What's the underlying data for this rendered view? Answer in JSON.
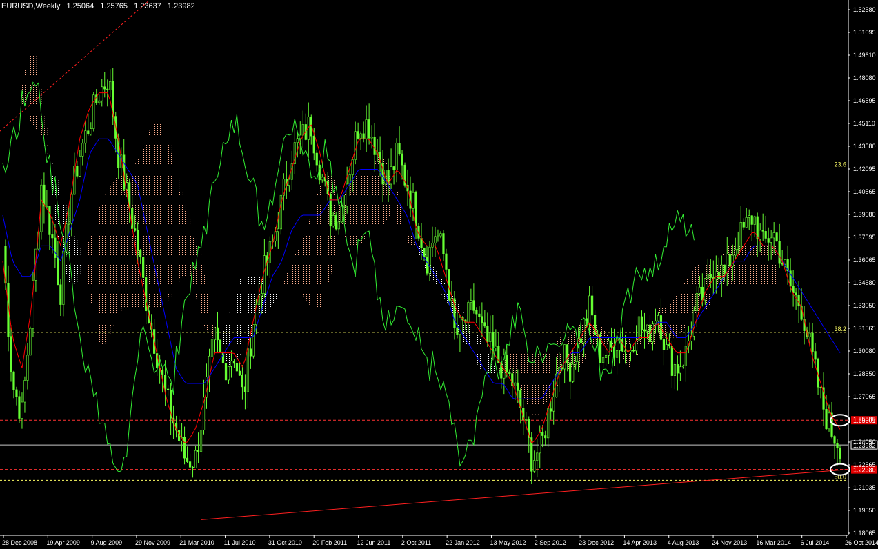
{
  "header": {
    "symbol": "EURUSD,Weekly",
    "open": "1.25064",
    "high": "1.25765",
    "low": "1.23637",
    "close": "1.23982"
  },
  "colors": {
    "background": "#000000",
    "candle": "#66ff33",
    "lagging": "#33ee33",
    "tenkan": "#ff0000",
    "kijun": "#0000ff",
    "cloud_bull": "#ffb090",
    "cloud_bear": "#ffffff",
    "fib": "#ffff66",
    "level": "#ff3333",
    "grid_axis": "#ffffff"
  },
  "chart_data": {
    "type": "candlestick",
    "title": "EURUSD,Weekly",
    "ylim": [
      1.1808,
      1.5307
    ],
    "y_ticks": [
      "1.52580",
      "1.51095",
      "1.49610",
      "1.48080",
      "1.46595",
      "1.45110",
      "1.43580",
      "1.42095",
      "1.40565",
      "1.39080",
      "1.37595",
      "1.36065",
      "1.34580",
      "1.33050",
      "1.31565",
      "1.30080",
      "1.28550",
      "1.27065",
      "1.25580",
      "1.24050",
      "1.22565",
      "1.21035",
      "1.19550",
      "1.18065"
    ],
    "x_ticks": [
      "28 Dec 2008",
      "19 Apr 2009",
      "9 Aug 2009",
      "29 Nov 2009",
      "21 Mar 2010",
      "11 Jul 2010",
      "31 Oct 2010",
      "20 Feb 2011",
      "12 Jun 2011",
      "2 Oct 2011",
      "22 Jan 2012",
      "13 May 2012",
      "2 Sep 2012",
      "23 Dec 2012",
      "14 Apr 2013",
      "4 Aug 2013",
      "24 Nov 2013",
      "16 Mar 2014",
      "6 Jul 2014",
      "26 Oct 2014"
    ],
    "price_series": [
      1.37,
      1.28,
      1.26,
      1.33,
      1.41,
      1.38,
      1.34,
      1.4,
      1.43,
      1.45,
      1.47,
      1.48,
      1.43,
      1.4,
      1.37,
      1.33,
      1.3,
      1.27,
      1.25,
      1.23,
      1.23,
      1.27,
      1.31,
      1.29,
      1.3,
      1.27,
      1.32,
      1.35,
      1.37,
      1.4,
      1.43,
      1.44,
      1.45,
      1.42,
      1.39,
      1.39,
      1.42,
      1.45,
      1.45,
      1.43,
      1.41,
      1.43,
      1.41,
      1.39,
      1.36,
      1.38,
      1.36,
      1.31,
      1.32,
      1.33,
      1.31,
      1.3,
      1.29,
      1.28,
      1.26,
      1.23,
      1.24,
      1.27,
      1.3,
      1.29,
      1.31,
      1.33,
      1.3,
      1.3,
      1.31,
      1.3,
      1.32,
      1.31,
      1.33,
      1.3,
      1.29,
      1.3,
      1.33,
      1.34,
      1.36,
      1.35,
      1.37,
      1.38,
      1.39,
      1.37,
      1.38,
      1.36,
      1.34,
      1.33,
      1.3,
      1.27,
      1.25,
      1.24
    ],
    "tenkan": [
      1.36,
      1.31,
      1.29,
      1.33,
      1.4,
      1.39,
      1.37,
      1.4,
      1.44,
      1.46,
      1.47,
      1.47,
      1.44,
      1.4,
      1.36,
      1.33,
      1.3,
      1.27,
      1.25,
      1.24,
      1.25,
      1.27,
      1.3,
      1.3,
      1.3,
      1.29,
      1.32,
      1.35,
      1.37,
      1.4,
      1.42,
      1.44,
      1.45,
      1.43,
      1.4,
      1.4,
      1.42,
      1.44,
      1.44,
      1.43,
      1.41,
      1.42,
      1.41,
      1.38,
      1.37,
      1.37,
      1.35,
      1.33,
      1.32,
      1.32,
      1.31,
      1.3,
      1.29,
      1.28,
      1.26,
      1.24,
      1.25,
      1.27,
      1.29,
      1.3,
      1.31,
      1.32,
      1.31,
      1.3,
      1.31,
      1.3,
      1.31,
      1.31,
      1.32,
      1.31,
      1.3,
      1.3,
      1.32,
      1.34,
      1.35,
      1.35,
      1.36,
      1.37,
      1.38,
      1.37,
      1.37,
      1.36,
      1.34,
      1.33,
      1.3,
      1.28,
      1.26,
      1.25
    ],
    "kijun": [
      1.39,
      1.36,
      1.35,
      1.35,
      1.37,
      1.37,
      1.36,
      1.38,
      1.4,
      1.43,
      1.44,
      1.44,
      1.43,
      1.42,
      1.41,
      1.38,
      1.35,
      1.32,
      1.29,
      1.28,
      1.28,
      1.28,
      1.29,
      1.3,
      1.31,
      1.31,
      1.31,
      1.33,
      1.35,
      1.36,
      1.38,
      1.39,
      1.39,
      1.39,
      1.4,
      1.4,
      1.41,
      1.42,
      1.42,
      1.42,
      1.41,
      1.4,
      1.39,
      1.37,
      1.36,
      1.35,
      1.34,
      1.32,
      1.31,
      1.3,
      1.29,
      1.28,
      1.28,
      1.27,
      1.27,
      1.27,
      1.27,
      1.28,
      1.29,
      1.3,
      1.3,
      1.31,
      1.31,
      1.31,
      1.31,
      1.31,
      1.31,
      1.31,
      1.32,
      1.32,
      1.31,
      1.31,
      1.32,
      1.33,
      1.34,
      1.35,
      1.36,
      1.36,
      1.37,
      1.37,
      1.37,
      1.36,
      1.35,
      1.34,
      1.33,
      1.32,
      1.31,
      1.3
    ],
    "span_a": [
      1.48,
      1.5,
      1.46,
      1.4,
      1.36,
      1.34,
      1.36,
      1.38,
      1.4,
      1.41,
      1.42,
      1.42,
      1.43,
      1.45,
      1.45,
      1.43,
      1.4,
      1.38,
      1.36,
      1.33,
      1.3,
      1.29,
      1.3,
      1.31,
      1.32,
      1.33,
      1.34,
      1.36,
      1.37,
      1.39,
      1.41,
      1.42,
      1.4,
      1.41,
      1.42,
      1.42,
      1.43,
      1.42,
      1.4,
      1.38,
      1.36,
      1.35,
      1.34,
      1.33,
      1.31,
      1.3,
      1.29,
      1.28,
      1.29,
      1.3,
      1.3,
      1.3,
      1.3,
      1.3,
      1.31,
      1.31,
      1.32,
      1.32,
      1.32,
      1.31,
      1.3,
      1.31,
      1.31,
      1.32,
      1.33,
      1.33,
      1.34,
      1.35,
      1.36,
      1.36,
      1.36,
      1.37,
      1.37,
      1.37,
      1.37,
      1.37,
      1.37
    ],
    "span_b": [
      1.46,
      1.45,
      1.44,
      1.42,
      1.4,
      1.38,
      1.36,
      1.33,
      1.3,
      1.32,
      1.33,
      1.33,
      1.33,
      1.33,
      1.33,
      1.34,
      1.35,
      1.35,
      1.32,
      1.31,
      1.31,
      1.33,
      1.35,
      1.35,
      1.35,
      1.34,
      1.34,
      1.34,
      1.34,
      1.33,
      1.33,
      1.35,
      1.38,
      1.37,
      1.37,
      1.38,
      1.38,
      1.39,
      1.38,
      1.37,
      1.37,
      1.36,
      1.35,
      1.34,
      1.33,
      1.32,
      1.31,
      1.3,
      1.28,
      1.29,
      1.28,
      1.26,
      1.26,
      1.27,
      1.28,
      1.29,
      1.29,
      1.3,
      1.3,
      1.3,
      1.3,
      1.29,
      1.3,
      1.3,
      1.31,
      1.31,
      1.31,
      1.32,
      1.32,
      1.33,
      1.34,
      1.34,
      1.34,
      1.34,
      1.34,
      1.34,
      1.34
    ],
    "fib_levels": [
      {
        "label": "23.6",
        "value": 1.4209
      },
      {
        "label": "38.2",
        "value": 1.3134
      },
      {
        "label": "50.0",
        "value": 1.2167
      }
    ],
    "price_levels": [
      {
        "label": "1.25601",
        "value": 1.25601,
        "style": "dashed-red"
      },
      {
        "label": "1.23982",
        "value": 1.23982,
        "style": "solid-white"
      },
      {
        "label": "1.22380",
        "value": 1.2238,
        "style": "dashed-red"
      }
    ],
    "trendlines": [
      {
        "from": [
          0.0,
          1.445
        ],
        "to": [
          0.175,
          1.53
        ],
        "style": "dashed-red"
      },
      {
        "from": [
          0.237,
          1.191
        ],
        "to": [
          1.0,
          1.2238
        ],
        "style": "solid-red"
      }
    ]
  }
}
